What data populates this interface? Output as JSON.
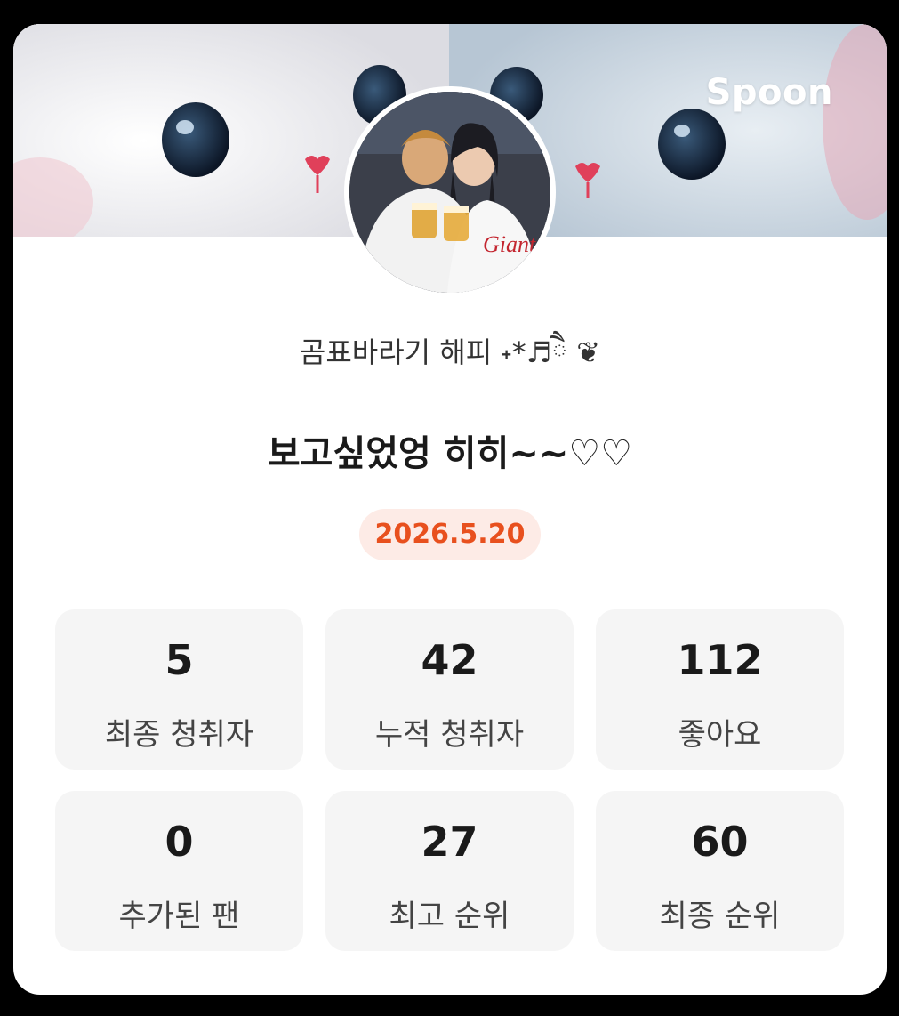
{
  "brand": {
    "logo_text": "Spoon"
  },
  "profile": {
    "nickname": "곰표바라기 해피 ˖*♬ཻ ❦",
    "avatar_description": "couple-photo"
  },
  "broadcast": {
    "title": "보고싶었엉 히히~~♡♡",
    "date": "2026.5.20"
  },
  "stats": [
    {
      "value": "5",
      "label": "최종 청취자"
    },
    {
      "value": "42",
      "label": "누적 청취자"
    },
    {
      "value": "112",
      "label": "좋아요"
    },
    {
      "value": "0",
      "label": "추가된 팬"
    },
    {
      "value": "27",
      "label": "최고 순위"
    },
    {
      "value": "60",
      "label": "최종 순위"
    }
  ],
  "colors": {
    "accent": "#e8501e",
    "badge_bg": "#fdebe6",
    "stat_bg": "#f5f5f5",
    "background": "#000000"
  }
}
